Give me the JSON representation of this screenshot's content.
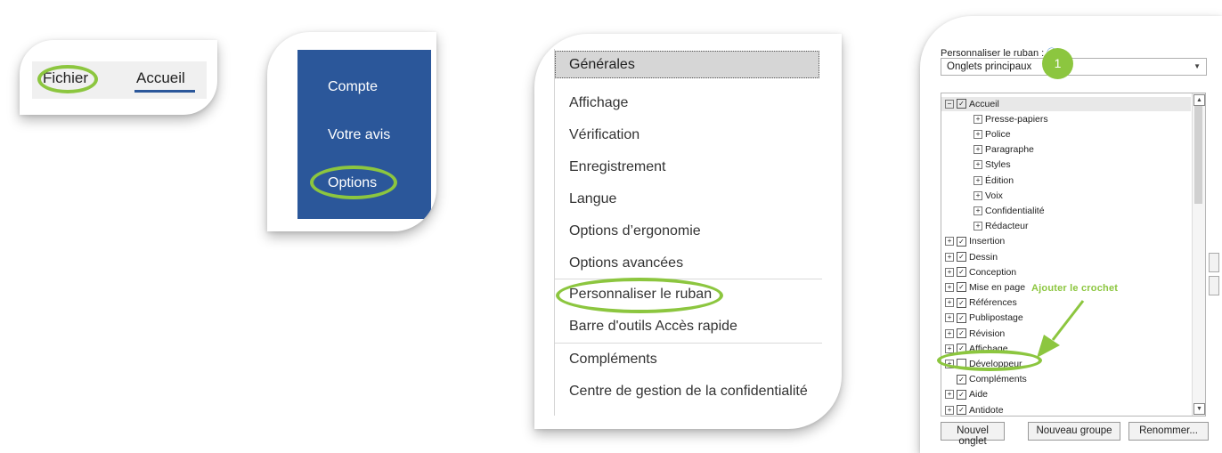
{
  "tabs": {
    "file": "Fichier",
    "home": "Accueil"
  },
  "backstage": {
    "items": [
      "Compte",
      "Votre avis",
      "Options"
    ]
  },
  "options": {
    "categories": [
      "Générales",
      "Affichage",
      "Vérification",
      "Enregistrement",
      "Langue",
      "Options d’ergonomie",
      "Options avancées",
      "Personnaliser le ruban",
      "Barre d'outils Accès rapide",
      "Compléments",
      "Centre de gestion de la confidentialité"
    ]
  },
  "ribbon": {
    "label": "Personnaliser le ruban :",
    "info_icon": "info-icon",
    "dropdown_value": "Onglets principaux",
    "step_badge": "1",
    "tree": [
      {
        "label": "Accueil",
        "expand": "⊟",
        "checked": true,
        "level": 0
      },
      {
        "label": "Presse-papiers",
        "expand": "⊞",
        "checked": null,
        "level": 1
      },
      {
        "label": "Police",
        "expand": "⊞",
        "checked": null,
        "level": 1
      },
      {
        "label": "Paragraphe",
        "expand": "⊞",
        "checked": null,
        "level": 1
      },
      {
        "label": "Styles",
        "expand": "⊞",
        "checked": null,
        "level": 1
      },
      {
        "label": "Édition",
        "expand": "⊞",
        "checked": null,
        "level": 1
      },
      {
        "label": "Voix",
        "expand": "⊞",
        "checked": null,
        "level": 1
      },
      {
        "label": "Confidentialité",
        "expand": "⊞",
        "checked": null,
        "level": 1
      },
      {
        "label": "Rédacteur",
        "expand": "⊞",
        "checked": null,
        "level": 1
      },
      {
        "label": "Insertion",
        "expand": "⊞",
        "checked": true,
        "level": 0
      },
      {
        "label": "Dessin",
        "expand": "⊞",
        "checked": true,
        "level": 0
      },
      {
        "label": "Conception",
        "expand": "⊞",
        "checked": true,
        "level": 0
      },
      {
        "label": "Mise en page",
        "expand": "⊞",
        "checked": true,
        "level": 0
      },
      {
        "label": "Références",
        "expand": "⊞",
        "checked": true,
        "level": 0
      },
      {
        "label": "Publipostage",
        "expand": "⊞",
        "checked": true,
        "level": 0
      },
      {
        "label": "Révision",
        "expand": "⊞",
        "checked": true,
        "level": 0
      },
      {
        "label": "Affichage",
        "expand": "⊞",
        "checked": true,
        "level": 0
      },
      {
        "label": "Développeur",
        "expand": "⊞",
        "checked": false,
        "level": 0
      },
      {
        "label": "Compléments",
        "expand": "",
        "checked": true,
        "level": 0
      },
      {
        "label": "Aide",
        "expand": "⊞",
        "checked": true,
        "level": 0
      },
      {
        "label": "Antidote",
        "expand": "⊞",
        "checked": true,
        "level": 0
      }
    ],
    "buttons": [
      "Nouvel onglet",
      "Nouveau groupe",
      "Renommer..."
    ],
    "annotation": "Ajouter le crochet"
  },
  "colors": {
    "accent_green": "#8cc63f",
    "word_blue": "#2b579a"
  }
}
